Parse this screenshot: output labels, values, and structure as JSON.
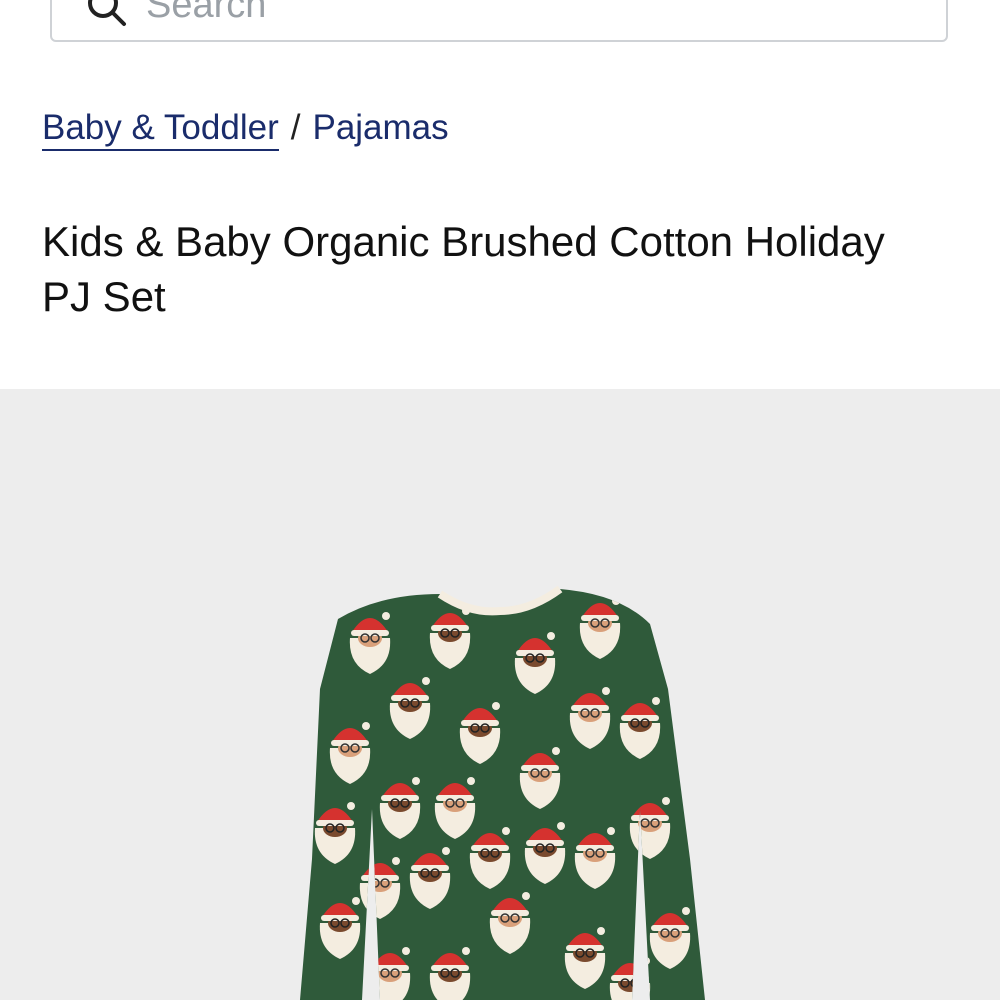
{
  "search": {
    "placeholder": "Search"
  },
  "breadcrumb": {
    "parent_label": "Baby & Toddler",
    "separator": "/",
    "current_label": "Pajamas"
  },
  "product": {
    "title": "Kids & Baby Organic Brushed Cotton Holiday PJ Set",
    "image_icon": "product-photo-pajama-top",
    "colors": {
      "fabric_green": "#2f5a3a",
      "santa_hat_red": "#d5322f",
      "beard_cream": "#f4ede0",
      "background_gray": "#ededed"
    }
  },
  "theme": {
    "link_color": "#1a2c6b",
    "text_color": "#111111"
  }
}
